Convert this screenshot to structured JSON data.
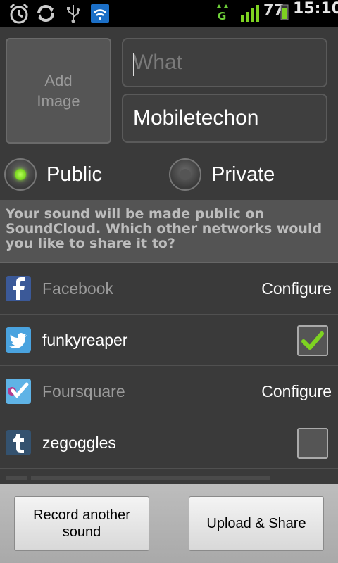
{
  "status_bar": {
    "battery_percent": "77",
    "time": "15:10",
    "network_type": "G",
    "icons": [
      "alarm-icon",
      "sync-icon",
      "usb-icon",
      "wifi-icon",
      "data-transfer-icon",
      "signal-icon",
      "battery-icon"
    ]
  },
  "form": {
    "add_image_label": "Add\nImage",
    "what_placeholder": "What",
    "what_value": "",
    "where_value": "Mobiletechon"
  },
  "privacy": {
    "public_label": "Public",
    "private_label": "Private",
    "selected": "Public"
  },
  "info_text": "Your sound will be made public on SoundCloud. Which other networks would you like to share it to?",
  "networks": [
    {
      "icon": "facebook-icon",
      "name": "Facebook",
      "action": "Configure",
      "checked": null
    },
    {
      "icon": "twitter-icon",
      "name": "funkyreaper",
      "action": "",
      "checked": true
    },
    {
      "icon": "foursquare-icon",
      "name": "Foursquare",
      "action": "Configure",
      "checked": null
    },
    {
      "icon": "tumblr-icon",
      "name": "zegoggles",
      "action": "",
      "checked": false
    }
  ],
  "colors": {
    "accent_green": "#7ed321",
    "background": "#3a3a3a",
    "facebook_blue": "#3b5998",
    "twitter_blue": "#4aa3df",
    "tumblr_navy": "#34526f"
  },
  "buttons": {
    "record_label": "Record another sound",
    "upload_label": "Upload & Share"
  }
}
